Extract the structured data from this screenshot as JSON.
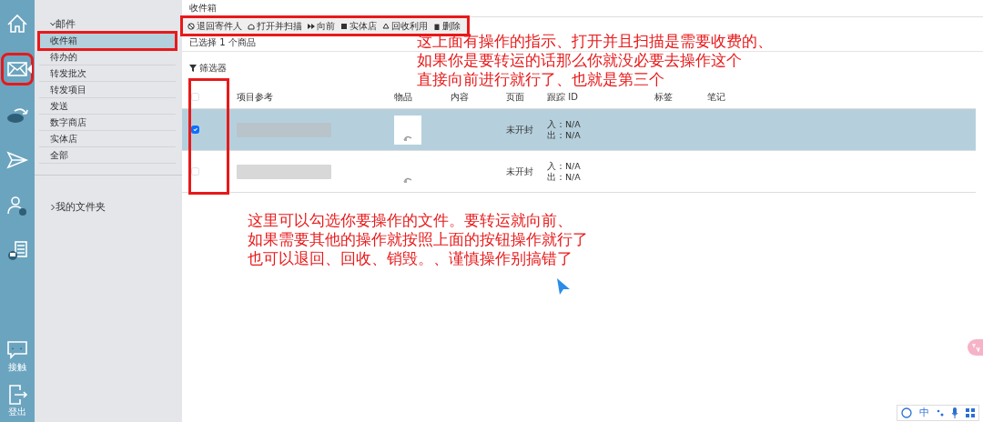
{
  "rail": {
    "items": [
      {
        "kind": "home",
        "selected": false,
        "framed": false
      },
      {
        "kind": "mail",
        "selected": true,
        "framed": true
      },
      {
        "kind": "cloud",
        "selected": false,
        "framed": false
      },
      {
        "kind": "send",
        "selected": false,
        "framed": false
      },
      {
        "kind": "user",
        "selected": false,
        "framed": false
      },
      {
        "kind": "store",
        "selected": false,
        "framed": false
      }
    ],
    "bottom": [
      {
        "kind": "chat",
        "label": "接触"
      },
      {
        "kind": "logout",
        "label": "登出"
      }
    ]
  },
  "sidebar": {
    "sections": [
      {
        "label": "邮件",
        "expanded": true,
        "items": [
          {
            "label": "收件箱",
            "selected": true,
            "framed": true
          },
          {
            "label": "待办的",
            "selected": false,
            "framed": false
          },
          {
            "label": "转发批次",
            "selected": false,
            "framed": false
          },
          {
            "label": "转发项目",
            "selected": false,
            "framed": false
          },
          {
            "label": "发送",
            "selected": false,
            "framed": false
          },
          {
            "label": "数字商店",
            "selected": false,
            "framed": false
          },
          {
            "label": "实体店",
            "selected": false,
            "framed": false
          },
          {
            "label": "全部",
            "selected": false,
            "framed": false
          }
        ]
      },
      {
        "label": "我的文件夹",
        "expanded": false
      }
    ]
  },
  "main": {
    "title": "收件箱",
    "toolbar_framed": true,
    "toolbar": [
      {
        "kind": "block",
        "label": "退回寄件人"
      },
      {
        "kind": "scan",
        "label": "打开并扫描"
      },
      {
        "kind": "forward",
        "label": "向前"
      },
      {
        "kind": "store",
        "label": "实体店"
      },
      {
        "kind": "recycle",
        "label": "回收利用"
      },
      {
        "kind": "trash",
        "label": "删除"
      }
    ],
    "selection_text": "已选择 1 个商品",
    "filter": "筛选器",
    "table": {
      "checkbox_column_framed": true,
      "select_all_checked": false,
      "columns": [
        "项目参考",
        "物品",
        "内容",
        "页面",
        "跟踪 ID",
        "标签",
        "笔记"
      ],
      "rows": [
        {
          "selected": true,
          "page": "未开封",
          "tracking_in": "入：N/A",
          "tracking_out": "出：N/A"
        },
        {
          "selected": false,
          "page": "未开封",
          "tracking_in": "入：N/A",
          "tracking_out": "出：N/A"
        }
      ]
    }
  },
  "annotations": [
    {
      "lines": [
        "这上面有操作的指示、打开并且扫描是需要收费的、",
        "如果你是要转运的话那么你就没必要去操作这个",
        "直接向前进行就行了、也就是第三个"
      ]
    },
    {
      "lines": [
        "这里可以勾选你要操作的文件。要转运就向前、",
        "如果需要其他的操作就按照上面的按钮操作就行了",
        "也可以退回、回收、销毁。、谨慎操作别搞错了"
      ]
    }
  ],
  "ime_toolbar": {
    "language": "中"
  }
}
